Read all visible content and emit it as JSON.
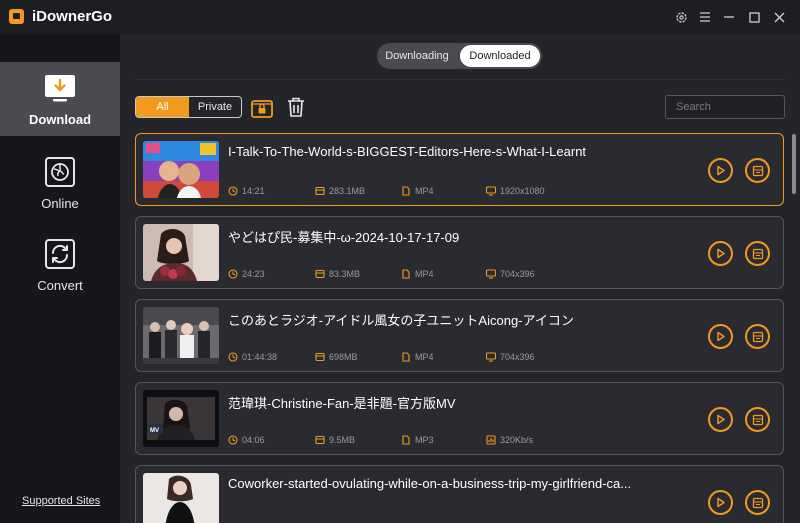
{
  "app": {
    "title": "iDownerGo"
  },
  "window_controls": [
    {
      "name": "settings-icon"
    },
    {
      "name": "menu-icon"
    },
    {
      "name": "minimize-icon"
    },
    {
      "name": "maximize-icon"
    },
    {
      "name": "close-icon"
    }
  ],
  "sidebar": {
    "items": [
      {
        "label": "Download",
        "icon": "download-icon",
        "active": true
      },
      {
        "label": "Online",
        "icon": "globe-icon",
        "active": false
      },
      {
        "label": "Convert",
        "icon": "convert-icon",
        "active": false
      }
    ],
    "supported_sites": "Supported Sites"
  },
  "tabs": {
    "downloading": "Downloading",
    "downloaded": "Downloaded",
    "selected": "Downloaded"
  },
  "filter": {
    "all": "All",
    "private": "Private",
    "selected": "All"
  },
  "search": {
    "placeholder": "Search",
    "value": ""
  },
  "colors": {
    "accent": "#f29a1b",
    "background": "#24252a",
    "sidebar": "#16171a"
  },
  "videos": [
    {
      "title": "I-Talk-To-The-World-s-BIGGEST-Editors-Here-s-What-I-Learnt",
      "duration": "14:21",
      "size": "283.1MB",
      "format": "MP4",
      "quality": "1920x1080",
      "quality_icon": "monitor-icon",
      "selected": true
    },
    {
      "title": "やどはぴ民-募集中-ω-2024-10-17-17-09",
      "duration": "24:23",
      "size": "83.3MB",
      "format": "MP4",
      "quality": "704x396",
      "quality_icon": "monitor-icon",
      "selected": false
    },
    {
      "title": "このあとラジオ-アイドル風女の子ユニットAicong-アイコン",
      "duration": "01:44:38",
      "size": "698MB",
      "format": "MP4",
      "quality": "704x396",
      "quality_icon": "monitor-icon",
      "selected": false
    },
    {
      "title": "范瑋琪-Christine-Fan-是非題-官方版MV",
      "duration": "04:06",
      "size": "9.5MB",
      "format": "MP3",
      "quality": "320Kb/s",
      "quality_icon": "audio-bars-icon",
      "selected": false
    },
    {
      "title": "Coworker-started-ovulating-while-on-a-business-trip-my-girlfriend-ca...",
      "duration": "",
      "size": "",
      "format": "",
      "quality": "",
      "quality_icon": "monitor-icon",
      "selected": false
    }
  ]
}
